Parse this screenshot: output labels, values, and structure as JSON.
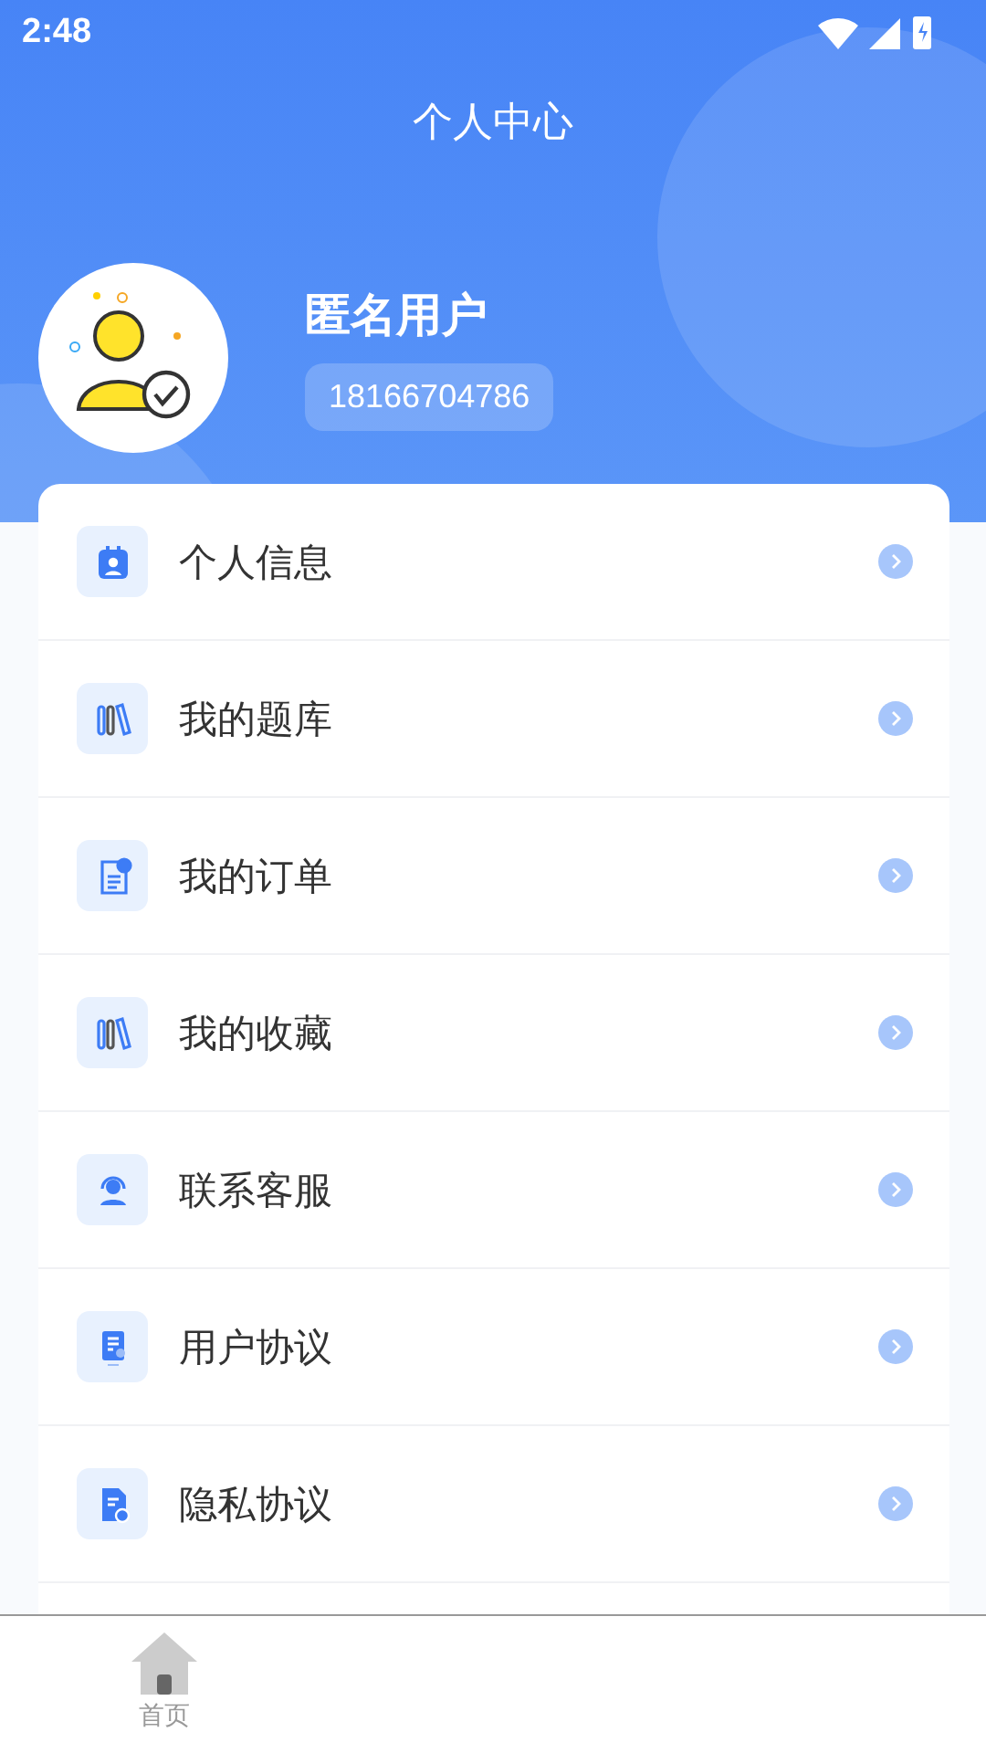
{
  "status_bar": {
    "time": "2:48"
  },
  "header": {
    "title": "个人中心"
  },
  "profile": {
    "name": "匿名用户",
    "phone": "18166704786"
  },
  "menu": [
    {
      "label": "个人信息"
    },
    {
      "label": "我的题库"
    },
    {
      "label": "我的订单"
    },
    {
      "label": "我的收藏"
    },
    {
      "label": "联系客服"
    },
    {
      "label": "用户协议"
    },
    {
      "label": "隐私协议"
    }
  ],
  "tabs": [
    {
      "label": "首页"
    }
  ]
}
